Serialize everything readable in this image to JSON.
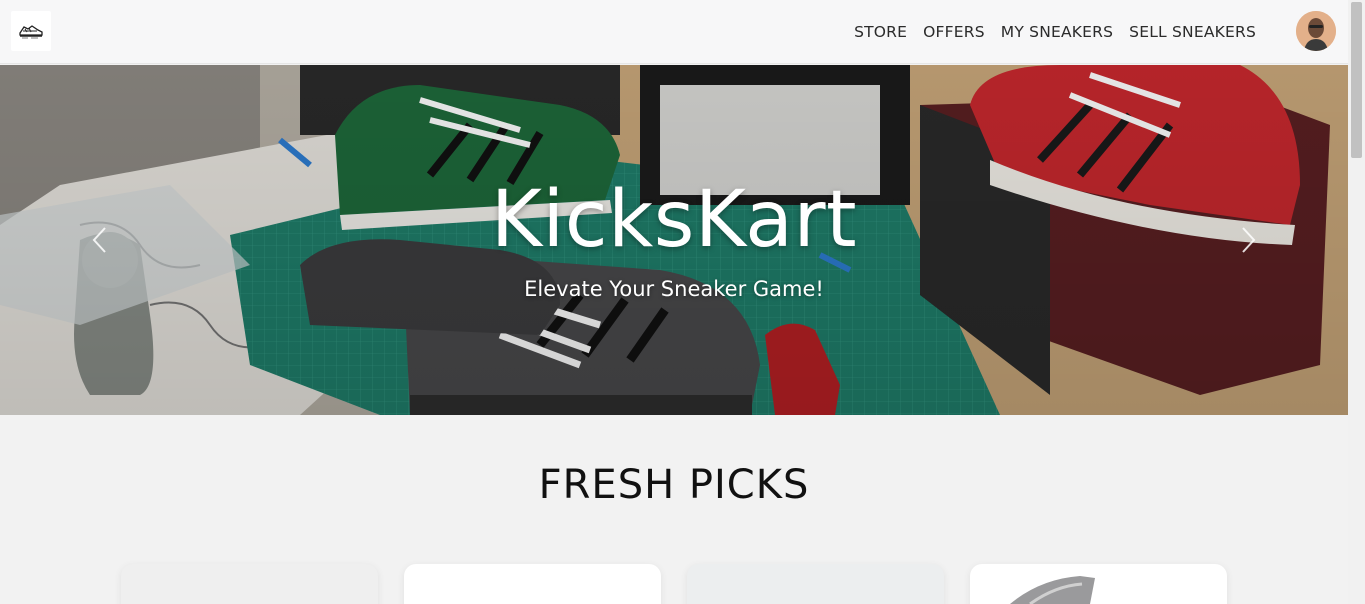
{
  "nav": {
    "logo_icon": "sneaker-logo-icon",
    "links": [
      "STORE",
      "OFFERS",
      "MY SNEAKERS",
      "SELL SNEAKERS"
    ],
    "avatar_icon": "user-avatar-icon"
  },
  "hero": {
    "title": "KicksKart",
    "subtitle": "Elevate Your Sneaker Game!",
    "prev_icon": "chevron-left-icon",
    "next_icon": "chevron-right-icon"
  },
  "section": {
    "title": "FRESH PICKS",
    "cards": [
      {
        "background": "#efefef"
      },
      {
        "background": "#ffffff"
      },
      {
        "background": "#eceeef"
      },
      {
        "background": "#ffffff"
      }
    ]
  }
}
